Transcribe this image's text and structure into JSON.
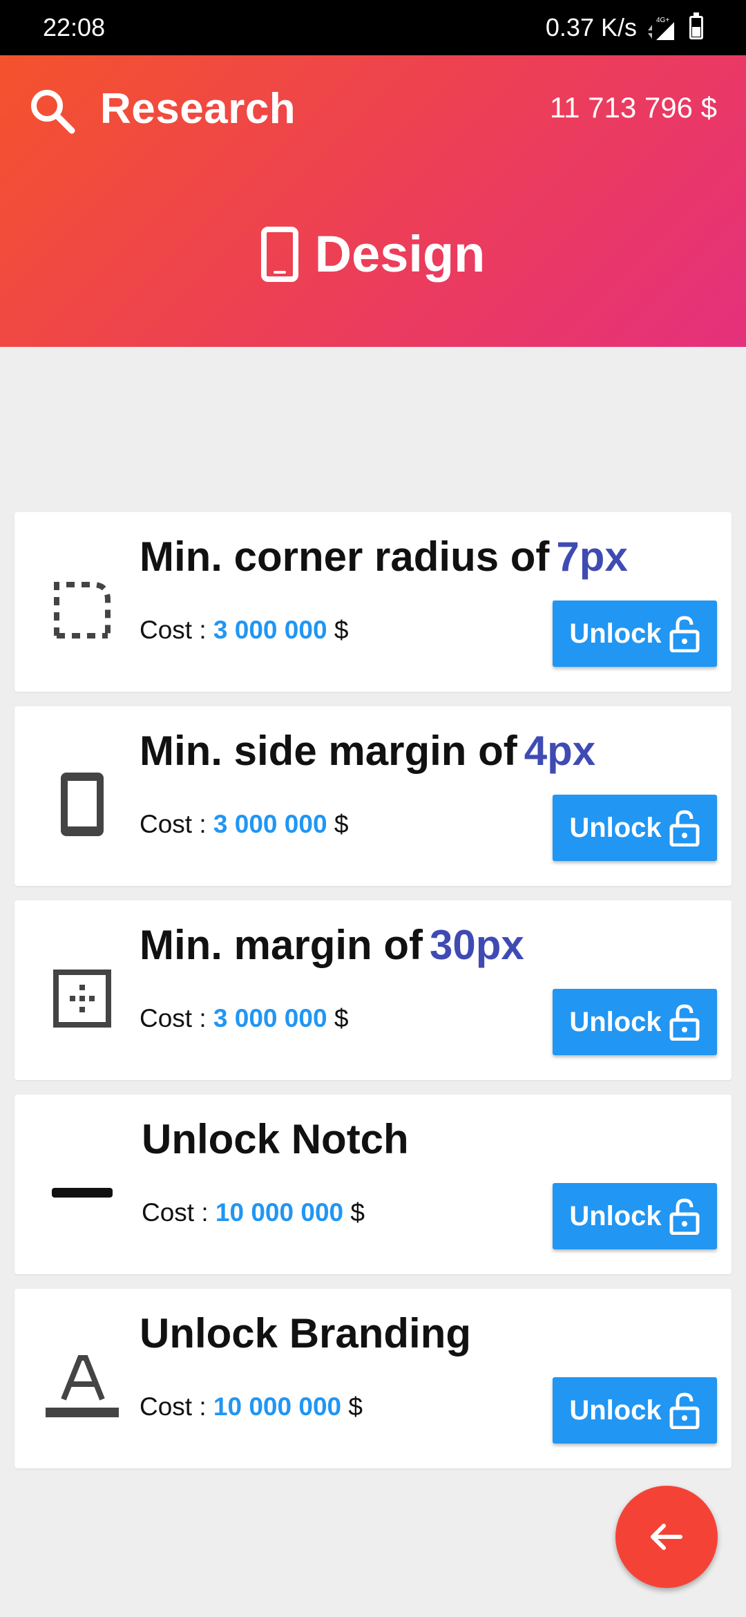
{
  "status_bar": {
    "time": "22:08",
    "speed": "0.37 K/s",
    "network": "4G+"
  },
  "header": {
    "title": "Research",
    "money": "11 713 796  $",
    "section_title": "Design",
    "section_icon": "smartphone-icon",
    "gradient": [
      "#f4532d",
      "#e5307c"
    ]
  },
  "cost_label": "Cost :",
  "currency": "$",
  "unlock_label": "Unlock",
  "items": [
    {
      "title": "Min. corner radius of",
      "highlight": "7px",
      "cost": "3 000 000",
      "icon": "corner-radius-icon"
    },
    {
      "title": "Min. side margin of",
      "highlight": "4px",
      "cost": "3 000 000",
      "icon": "phone-outline-icon"
    },
    {
      "title": "Min. margin of",
      "highlight": "30px",
      "cost": "3 000 000",
      "icon": "margin-grid-icon"
    },
    {
      "title": "Unlock Notch",
      "highlight": "",
      "cost": "10 000 000",
      "icon": "notch-icon"
    },
    {
      "title": "Unlock Branding",
      "highlight": "",
      "cost": "10 000 000",
      "icon": "branding-text-icon"
    }
  ],
  "colors": {
    "accent": "#2196f3",
    "highlight": "#3f4bb3",
    "fab": "#f44336"
  }
}
